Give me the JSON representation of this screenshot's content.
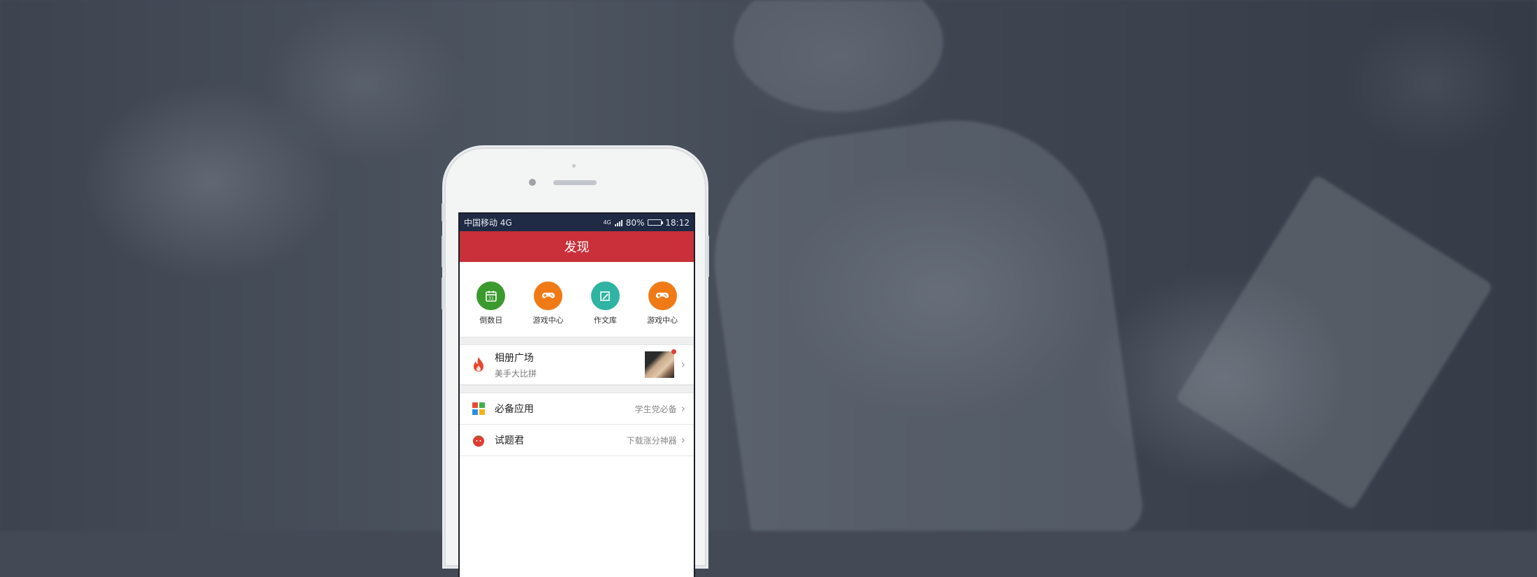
{
  "status_bar": {
    "carrier": "中国移动 4G",
    "network": "4G",
    "battery": "80%",
    "battery_level": 0.8,
    "time": "18:12"
  },
  "nav": {
    "title": "发现"
  },
  "shortcuts": [
    {
      "label": "倒数日",
      "color": "#3a9a2e",
      "icon": "calendar-icon",
      "icon_text": "31"
    },
    {
      "label": "游戏中心",
      "color": "#f07a16",
      "icon": "gamepad-icon"
    },
    {
      "label": "作文库",
      "color": "#2fb3a2",
      "icon": "edit-icon"
    },
    {
      "label": "游戏中心",
      "color": "#f07a16",
      "icon": "gamepad-icon"
    }
  ],
  "album": {
    "title": "相册广场",
    "subtitle": "美手大比拼",
    "icon": "flame-icon",
    "icon_color": "#e8462e"
  },
  "list": [
    {
      "title": "必备应用",
      "right": "学生党必备",
      "icon": "apps-grid-icon"
    },
    {
      "title": "试题君",
      "right": "下载涨分神器",
      "icon": "tomato-icon"
    }
  ],
  "colors": {
    "brand_red": "#c9303a",
    "status_bar": "#1f2a44"
  }
}
